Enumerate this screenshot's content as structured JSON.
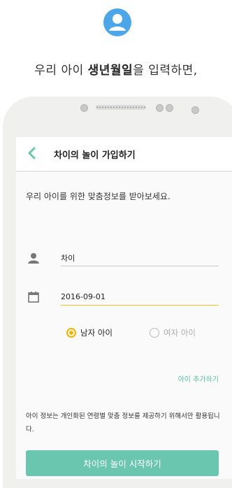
{
  "headline": {
    "prefix": "우리 아이 ",
    "highlight": "생년월일",
    "suffix": "을 입력하면,"
  },
  "appbar": {
    "title": "차이의 놀이 가입하기"
  },
  "form": {
    "intro": "우리 아이를 위한 맞춤정보를 받아보세요.",
    "name_value": "차이",
    "birth_value": "2016-09-01",
    "gender_options": [
      "남자 아이",
      "여자 아이"
    ],
    "gender_selected": "남자 아이",
    "add_child_label": "아이 추가하기",
    "notice": "아이 정보는 개인화된 연령별 맞춤 정보를 제공하기 위해서만 활용됩니다.",
    "start_button": "차이의 놀이 시작하기"
  },
  "colors": {
    "accent_teal": "#6bc6b0",
    "accent_yellow": "#f0b400",
    "avatar_blue": "#4da6e8"
  },
  "icons": [
    "user-avatar-icon",
    "back-chevron-icon",
    "person-icon",
    "calendar-icon"
  ]
}
